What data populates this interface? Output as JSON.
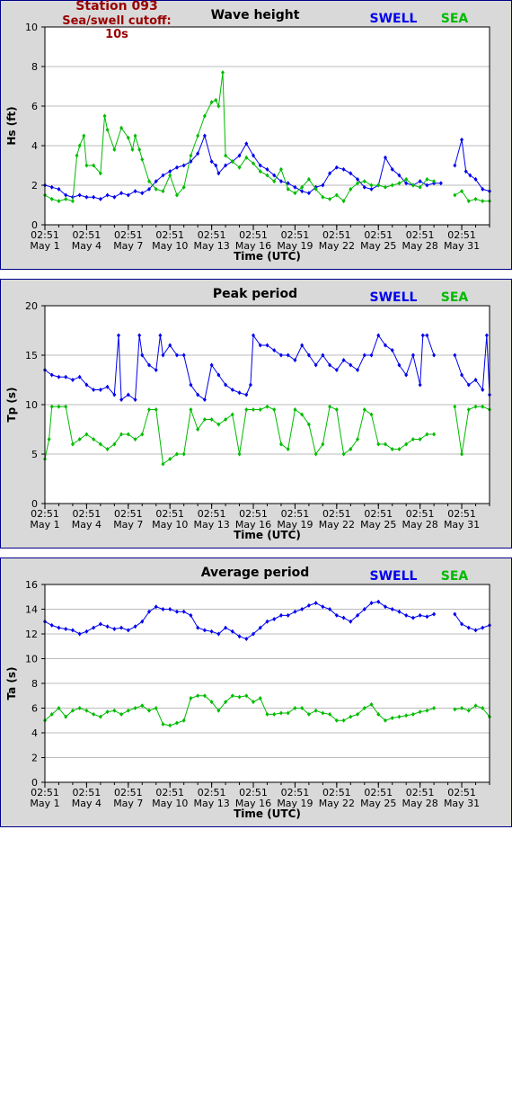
{
  "station": {
    "title": "Station 093",
    "cutoff": "Sea/swell cutoff: 10s"
  },
  "colors": {
    "swell": "#0000ee",
    "sea": "#00bb00",
    "station_text": "#990000",
    "frame_bg": "#d9d9d9",
    "frame_border": "#000088"
  },
  "x_ticks": [
    {
      "time": "02:51",
      "date": "May 1"
    },
    {
      "time": "02:51",
      "date": "May 4"
    },
    {
      "time": "02:51",
      "date": "May 7"
    },
    {
      "time": "02:51",
      "date": "May 10"
    },
    {
      "time": "02:51",
      "date": "May 13"
    },
    {
      "time": "02:51",
      "date": "May 16"
    },
    {
      "time": "02:51",
      "date": "May 19"
    },
    {
      "time": "02:51",
      "date": "May 22"
    },
    {
      "time": "02:51",
      "date": "May 25"
    },
    {
      "time": "02:51",
      "date": "May 28"
    },
    {
      "time": "02:51",
      "date": "May 31"
    }
  ],
  "chart_data": [
    {
      "type": "line",
      "title": "Wave height",
      "xlabel": "Time (UTC)",
      "ylabel": "Hs (ft)",
      "ylim": [
        0,
        10
      ],
      "yticks": [
        "0",
        "2",
        "4",
        "6",
        "8",
        "10"
      ],
      "xlim_days": [
        1,
        33
      ],
      "grid": true,
      "legend": "top-right",
      "series": [
        {
          "name": "SWELL",
          "color": "#0000ee",
          "x": [
            1,
            1.5,
            2,
            2.5,
            3,
            3.5,
            4,
            4.5,
            5,
            5.5,
            6,
            6.5,
            7,
            7.5,
            8,
            8.5,
            9,
            9.5,
            10,
            10.5,
            11,
            11.5,
            12,
            12.5,
            13,
            13.3,
            13.5,
            14,
            14.5,
            15,
            15.5,
            16,
            16.5,
            17,
            17.5,
            18,
            18.5,
            19,
            19.5,
            20,
            20.5,
            21,
            21.5,
            22,
            22.5,
            23,
            23.5,
            24,
            24.5,
            25,
            25.5,
            26,
            26.5,
            27,
            27.5,
            28,
            28.5,
            29,
            29.5,
            null,
            30.5,
            31,
            31.3,
            31.6,
            32,
            32.5,
            33
          ],
          "y": [
            2.0,
            1.9,
            1.8,
            1.5,
            1.4,
            1.5,
            1.4,
            1.4,
            1.3,
            1.5,
            1.4,
            1.6,
            1.5,
            1.7,
            1.6,
            1.8,
            2.2,
            2.5,
            2.7,
            2.9,
            3.0,
            3.2,
            3.6,
            4.5,
            3.2,
            3.0,
            2.6,
            3.0,
            3.2,
            3.5,
            4.1,
            3.5,
            3.0,
            2.8,
            2.5,
            2.2,
            2.1,
            1.9,
            1.7,
            1.6,
            1.9,
            2.0,
            2.6,
            2.9,
            2.8,
            2.6,
            2.3,
            1.9,
            1.8,
            2.0,
            3.4,
            2.8,
            2.5,
            2.1,
            2.0,
            2.2,
            2.0,
            2.1,
            2.1,
            null,
            3.0,
            4.3,
            2.7,
            2.5,
            2.3,
            1.8,
            1.7
          ]
        },
        {
          "name": "SEA",
          "color": "#00bb00",
          "x": [
            1,
            1.5,
            2,
            2.5,
            3,
            3.3,
            3.5,
            3.8,
            4,
            4.5,
            5,
            5.3,
            5.5,
            6,
            6.5,
            7,
            7.3,
            7.5,
            7.8,
            8,
            8.5,
            9,
            9.5,
            10,
            10.5,
            11,
            11.5,
            12,
            12.5,
            13,
            13.3,
            13.5,
            13.8,
            14,
            14.5,
            15,
            15.5,
            16,
            16.5,
            17,
            17.5,
            18,
            18.5,
            19,
            19.5,
            20,
            20.5,
            21,
            21.5,
            22,
            22.5,
            23,
            23.5,
            24,
            24.5,
            25,
            25.5,
            26,
            26.5,
            27,
            27.5,
            28,
            28.5,
            29,
            null,
            30.5,
            31,
            31.5,
            32,
            32.5,
            33
          ],
          "y": [
            1.5,
            1.3,
            1.2,
            1.3,
            1.2,
            3.5,
            4.0,
            4.5,
            3.0,
            3.0,
            2.6,
            5.5,
            4.8,
            3.8,
            4.9,
            4.4,
            3.8,
            4.5,
            3.8,
            3.3,
            2.2,
            1.8,
            1.7,
            2.5,
            1.5,
            1.9,
            3.5,
            4.5,
            5.5,
            6.2,
            6.3,
            6.0,
            7.7,
            3.5,
            3.2,
            2.9,
            3.4,
            3.1,
            2.7,
            2.5,
            2.2,
            2.8,
            1.8,
            1.6,
            1.9,
            2.3,
            1.8,
            1.4,
            1.3,
            1.5,
            1.2,
            1.8,
            2.1,
            2.2,
            2.0,
            2.0,
            1.9,
            2.0,
            2.1,
            2.3,
            2.0,
            1.9,
            2.3,
            2.2,
            null,
            1.5,
            1.7,
            1.2,
            1.3,
            1.2,
            1.2
          ]
        }
      ]
    },
    {
      "type": "line",
      "title": "Peak period",
      "xlabel": "Time (UTC)",
      "ylabel": "Tp (s)",
      "ylim": [
        0,
        20
      ],
      "yticks": [
        "0",
        "5",
        "10",
        "15",
        "20"
      ],
      "xlim_days": [
        1,
        33
      ],
      "grid": true,
      "legend": "top-right",
      "series": [
        {
          "name": "SWELL",
          "color": "#0000ee",
          "x": [
            1,
            1.5,
            2,
            2.5,
            3,
            3.5,
            4,
            4.5,
            5,
            5.5,
            6,
            6.3,
            6.5,
            7,
            7.5,
            7.8,
            8,
            8.5,
            9,
            9.3,
            9.5,
            10,
            10.5,
            11,
            11.5,
            12,
            12.5,
            13,
            13.5,
            14,
            14.5,
            15,
            15.5,
            15.8,
            16,
            16.5,
            17,
            17.5,
            18,
            18.5,
            19,
            19.5,
            20,
            20.5,
            21,
            21.5,
            22,
            22.5,
            23,
            23.5,
            24,
            24.5,
            25,
            25.5,
            26,
            26.5,
            27,
            27.5,
            28,
            28.2,
            28.5,
            29,
            null,
            30.5,
            31,
            31.5,
            32,
            32.5,
            32.8,
            33
          ],
          "y": [
            13.5,
            13.0,
            12.8,
            12.8,
            12.5,
            12.8,
            12.0,
            11.5,
            11.5,
            11.8,
            11.0,
            17.0,
            10.5,
            11.0,
            10.5,
            17.0,
            15.0,
            14.0,
            13.5,
            17.0,
            15.0,
            16.0,
            15.0,
            15.0,
            12.0,
            11.0,
            10.5,
            14.0,
            13.0,
            12.0,
            11.5,
            11.2,
            11.0,
            12.0,
            17.0,
            16.0,
            16.0,
            15.5,
            15.0,
            15.0,
            14.5,
            16.0,
            15.0,
            14.0,
            15.0,
            14.0,
            13.5,
            14.5,
            14.0,
            13.5,
            15.0,
            15.0,
            17.0,
            16.0,
            15.5,
            14.0,
            13.0,
            15.0,
            12.0,
            17.0,
            17.0,
            15.0,
            null,
            15.0,
            13.0,
            12.0,
            12.5,
            11.5,
            17.0,
            11.0
          ]
        },
        {
          "name": "SEA",
          "color": "#00bb00",
          "x": [
            1,
            1.3,
            1.5,
            2,
            2.5,
            3,
            3.5,
            4,
            4.5,
            5,
            5.5,
            6,
            6.5,
            7,
            7.5,
            8,
            8.5,
            9,
            9.5,
            10,
            10.5,
            11,
            11.5,
            12,
            12.5,
            13,
            13.5,
            14,
            14.5,
            15,
            15.5,
            16,
            16.5,
            17,
            17.5,
            18,
            18.5,
            19,
            19.5,
            20,
            20.5,
            21,
            21.5,
            22,
            22.5,
            23,
            23.5,
            24,
            24.5,
            25,
            25.5,
            26,
            26.5,
            27,
            27.5,
            28,
            28.5,
            29,
            null,
            30.5,
            31,
            31.5,
            32,
            32.5,
            33
          ],
          "y": [
            4.5,
            6.5,
            9.8,
            9.8,
            9.8,
            6.0,
            6.5,
            7.0,
            6.5,
            6.0,
            5.5,
            6.0,
            7.0,
            7.0,
            6.5,
            7.0,
            9.5,
            9.5,
            4.0,
            4.5,
            5.0,
            5.0,
            9.5,
            7.5,
            8.5,
            8.5,
            8.0,
            8.5,
            9.0,
            5.0,
            9.5,
            9.5,
            9.5,
            9.8,
            9.5,
            6.0,
            5.5,
            9.5,
            9.0,
            8.0,
            5.0,
            6.0,
            9.8,
            9.5,
            5.0,
            5.5,
            6.5,
            9.5,
            9.0,
            6.0,
            6.0,
            5.5,
            5.5,
            6.0,
            6.5,
            6.5,
            7.0,
            7.0,
            null,
            9.8,
            5.0,
            9.5,
            9.8,
            9.8,
            9.5
          ]
        }
      ]
    },
    {
      "type": "line",
      "title": "Average period",
      "xlabel": "Time (UTC)",
      "ylabel": "Ta (s)",
      "ylim": [
        0,
        16
      ],
      "yticks": [
        "0",
        "2",
        "4",
        "6",
        "8",
        "10",
        "12",
        "14",
        "16"
      ],
      "xlim_days": [
        1,
        33
      ],
      "grid": true,
      "legend": "top-right",
      "series": [
        {
          "name": "SWELL",
          "color": "#0000ee",
          "x": [
            1,
            1.5,
            2,
            2.5,
            3,
            3.5,
            4,
            4.5,
            5,
            5.5,
            6,
            6.5,
            7,
            7.5,
            8,
            8.5,
            9,
            9.5,
            10,
            10.5,
            11,
            11.5,
            12,
            12.5,
            13,
            13.5,
            14,
            14.5,
            15,
            15.5,
            16,
            16.5,
            17,
            17.5,
            18,
            18.5,
            19,
            19.5,
            20,
            20.5,
            21,
            21.5,
            22,
            22.5,
            23,
            23.5,
            24,
            24.5,
            25,
            25.5,
            26,
            26.5,
            27,
            27.5,
            28,
            28.5,
            29,
            null,
            30.5,
            31,
            31.5,
            32,
            32.5,
            33
          ],
          "y": [
            13.0,
            12.7,
            12.5,
            12.4,
            12.3,
            12.0,
            12.2,
            12.5,
            12.8,
            12.6,
            12.4,
            12.5,
            12.3,
            12.6,
            13.0,
            13.8,
            14.2,
            14.0,
            14.0,
            13.8,
            13.8,
            13.5,
            12.5,
            12.3,
            12.2,
            12.0,
            12.5,
            12.2,
            11.8,
            11.6,
            12.0,
            12.5,
            13.0,
            13.2,
            13.5,
            13.5,
            13.8,
            14.0,
            14.3,
            14.5,
            14.2,
            14.0,
            13.5,
            13.3,
            13.0,
            13.5,
            14.0,
            14.5,
            14.6,
            14.2,
            14.0,
            13.8,
            13.5,
            13.3,
            13.5,
            13.4,
            13.6,
            null,
            13.6,
            12.8,
            12.5,
            12.3,
            12.5,
            12.7
          ]
        },
        {
          "name": "SEA",
          "color": "#00bb00",
          "x": [
            1,
            1.5,
            2,
            2.5,
            3,
            3.5,
            4,
            4.5,
            5,
            5.5,
            6,
            6.5,
            7,
            7.5,
            8,
            8.5,
            9,
            9.5,
            10,
            10.5,
            11,
            11.5,
            12,
            12.5,
            13,
            13.5,
            14,
            14.5,
            15,
            15.5,
            16,
            16.5,
            17,
            17.5,
            18,
            18.5,
            19,
            19.5,
            20,
            20.5,
            21,
            21.5,
            22,
            22.5,
            23,
            23.5,
            24,
            24.5,
            25,
            25.5,
            26,
            26.5,
            27,
            27.5,
            28,
            28.5,
            29,
            null,
            30.5,
            31,
            31.5,
            32,
            32.5,
            33
          ],
          "y": [
            5.0,
            5.5,
            6.0,
            5.3,
            5.8,
            6.0,
            5.8,
            5.5,
            5.3,
            5.7,
            5.8,
            5.5,
            5.8,
            6.0,
            6.2,
            5.8,
            6.0,
            4.7,
            4.6,
            4.8,
            5.0,
            6.8,
            7.0,
            7.0,
            6.5,
            5.8,
            6.5,
            7.0,
            6.9,
            7.0,
            6.5,
            6.8,
            5.5,
            5.5,
            5.6,
            5.6,
            6.0,
            6.0,
            5.5,
            5.8,
            5.6,
            5.5,
            5.0,
            5.0,
            5.3,
            5.5,
            6.0,
            6.3,
            5.5,
            5.0,
            5.2,
            5.3,
            5.4,
            5.5,
            5.7,
            5.8,
            6.0,
            null,
            5.9,
            6.0,
            5.8,
            6.2,
            6.0,
            5.3
          ]
        }
      ]
    }
  ]
}
